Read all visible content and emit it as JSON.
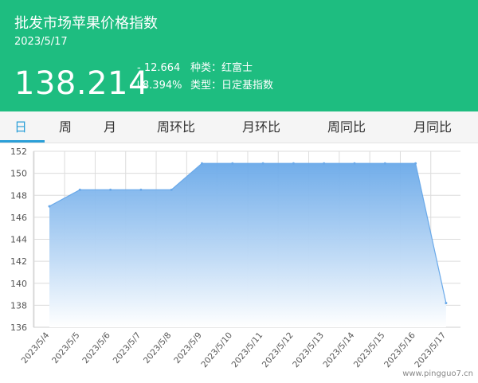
{
  "header": {
    "title": "批发市场苹果价格指数",
    "date": "2023/5/17",
    "price": "138.214",
    "change_abs": "- 12.664",
    "change_pct": "↓8.394%",
    "variety": "种类：红富士",
    "index_type": "类型：日定基指数"
  },
  "tabs": [
    {
      "label": "日",
      "active": true
    },
    {
      "label": "周",
      "active": false
    },
    {
      "label": "月",
      "active": false
    },
    {
      "label": "周环比",
      "active": false
    },
    {
      "label": "月环比",
      "active": false
    },
    {
      "label": "周同比",
      "active": false
    },
    {
      "label": "月同比",
      "active": false
    }
  ],
  "colors": {
    "header_bg": "#1ebd80",
    "accent": "#2a9fd8",
    "area_top": "#6aa9e9",
    "area_bottom": "#ffffff",
    "line": "#6aa9e9"
  },
  "watermark": "www.pingguo7.cn",
  "chart_data": {
    "type": "area",
    "x": [
      "2023/5/4",
      "2023/5/5",
      "2023/5/6",
      "2023/5/7",
      "2023/5/8",
      "2023/5/9",
      "2023/5/10",
      "2023/5/11",
      "2023/5/12",
      "2023/5/13",
      "2023/5/14",
      "2023/5/15",
      "2023/5/16",
      "2023/5/17"
    ],
    "values": [
      147.0,
      148.5,
      148.5,
      148.5,
      148.5,
      150.9,
      150.9,
      150.9,
      150.9,
      150.9,
      150.9,
      150.9,
      150.9,
      138.2
    ],
    "y_ticks": [
      "136",
      "138",
      "140",
      "142",
      "144",
      "146",
      "148",
      "150",
      "152"
    ],
    "ylim": [
      136,
      152
    ],
    "grid": true,
    "legend": "none"
  }
}
